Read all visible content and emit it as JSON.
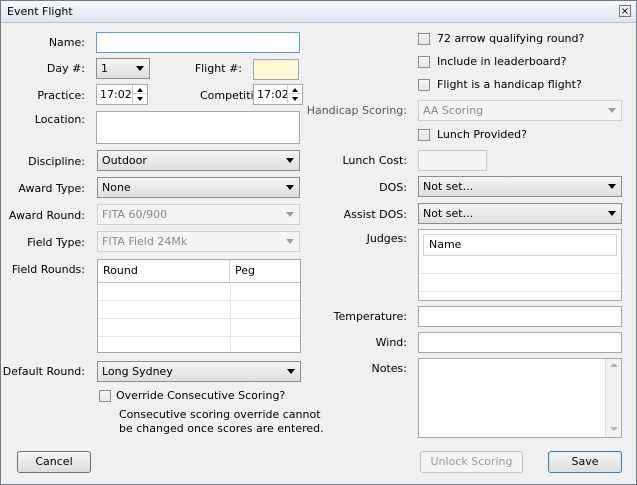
{
  "window": {
    "title": "Event Flight",
    "close_symbol": "×"
  },
  "left": {
    "name_label": "Name:",
    "name_value": "",
    "day_label": "Day #:",
    "day_value": "1",
    "flight_label": "Flight #:",
    "flight_value": "",
    "practice_label": "Practice:",
    "practice_value": "17:02",
    "competition_label": "Competition:",
    "competition_value": "17:02",
    "location_label": "Location:",
    "location_value": "",
    "discipline_label": "Discipline:",
    "discipline_value": "Outdoor",
    "award_type_label": "Award Type:",
    "award_type_value": "None",
    "award_round_label": "Award Round:",
    "award_round_value": "FITA 60/900",
    "field_type_label": "Field Type:",
    "field_type_value": "FITA Field 24Mk",
    "field_rounds_label": "Field Rounds:",
    "field_rounds_columns": [
      "Round",
      "Peg"
    ],
    "default_round_label": "Default Round:",
    "default_round_value": "Long Sydney",
    "override_label": "Override Consecutive Scoring?",
    "override_note_1": "Consecutive scoring override cannot",
    "override_note_2": "be changed once scores are entered."
  },
  "right": {
    "qualifying_label": "72 arrow qualifying round?",
    "leaderboard_label": "Include in leaderboard?",
    "handicap_flight_label": "Flight is a handicap flight?",
    "handicap_scoring_label": "Handicap Scoring:",
    "handicap_scoring_value": "AA Scoring",
    "lunch_provided_label": "Lunch Provided?",
    "lunch_cost_label": "Lunch Cost:",
    "lunch_cost_value": "",
    "dos_label": "DOS:",
    "dos_value": "Not set...",
    "assist_dos_label": "Assist DOS:",
    "assist_dos_value": "Not set...",
    "judges_label": "Judges:",
    "judges_column": "Name",
    "temperature_label": "Temperature:",
    "temperature_value": "",
    "wind_label": "Wind:",
    "wind_value": "",
    "notes_label": "Notes:",
    "notes_value": ""
  },
  "buttons": {
    "cancel": "Cancel",
    "unlock": "Unlock Scoring",
    "save": "Save"
  }
}
